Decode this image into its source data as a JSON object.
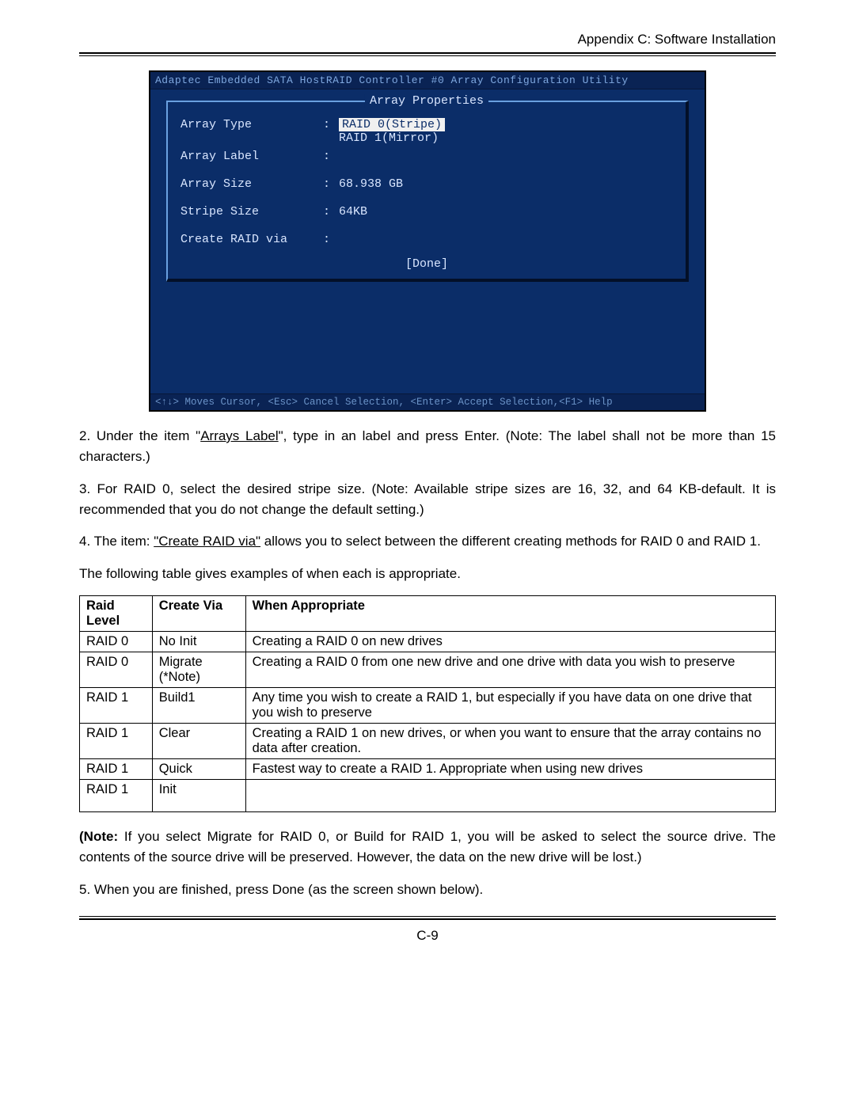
{
  "header": "Appendix C: Software Installation",
  "bios": {
    "title": "Adaptec Embedded SATA HostRAID Controller #0 Array Configuration Utility",
    "panel_title": "Array Properties",
    "rows": {
      "type_label": "Array Type",
      "type_opt1": "RAID 0(Stripe)",
      "type_opt2": "RAID 1(Mirror)",
      "label_label": "Array Label",
      "label_val": "",
      "size_label": "Array Size",
      "size_val": "68.938 GB",
      "stripe_label": "Stripe Size",
      "stripe_val": "64KB",
      "create_label": "Create RAID via",
      "create_val": ""
    },
    "done": "[Done]",
    "footer": "<↑↓> Moves Cursor, <Esc> Cancel Selection, <Enter> Accept Selection,<F1> Help"
  },
  "text": {
    "p2a": "2. Under the item \"",
    "p2u": "Arrays Label",
    "p2b": "\",  type in an label and press Enter. (Note: The label shall not be more than 15 characters.)",
    "p3": "3. For RAID 0, select the desired stripe size. (Note: Available stripe sizes are 16, 32, and 64 KB-default. It is recommended that you do not change the default setting.)",
    "p4a": "4. The item: ",
    "p4u": "\"Create RAID via\"",
    "p4b": " allows you to select between the different creating methods for RAID 0 and RAID 1.",
    "p5": "The following table gives examples of when each is appropriate.",
    "note_b": "(Note:",
    "note": " If you select Migrate for RAID 0, or Build for RAID 1, you will be asked to select the source drive. The contents of the source drive will be preserved. However, the data on the new drive will be lost.)",
    "p6": "5. When you are finished, press Done (as the screen shown below)."
  },
  "table": {
    "h1": "Raid Level",
    "h2": "Create Via",
    "h3": "When Appropriate",
    "rows": [
      {
        "c1": "RAID 0",
        "c2": "No Init",
        "c3": "Creating a RAID 0 on new drives"
      },
      {
        "c1": "RAID 0",
        "c2": "Migrate (*Note)",
        "c3": "Creating a RAID 0 from one new drive and one drive with data you wish to preserve"
      },
      {
        "c1": "RAID 1",
        "c2": "Build1",
        "c3": "Any time you wish to create a RAID 1, but especially if you have data on one drive that you wish to preserve"
      },
      {
        "c1": "RAID 1",
        "c2": "Clear",
        "c3": "Creating a RAID 1 on new drives, or when you want to ensure that the array contains no data after creation."
      },
      {
        "c1": "RAID 1",
        "c2": "Quick",
        "c3": "Fastest way to create a RAID 1. Appropriate when using new drives"
      },
      {
        "c1": "RAID 1",
        "c2": "Init",
        "c3": ""
      }
    ]
  },
  "page_num": "C-9"
}
